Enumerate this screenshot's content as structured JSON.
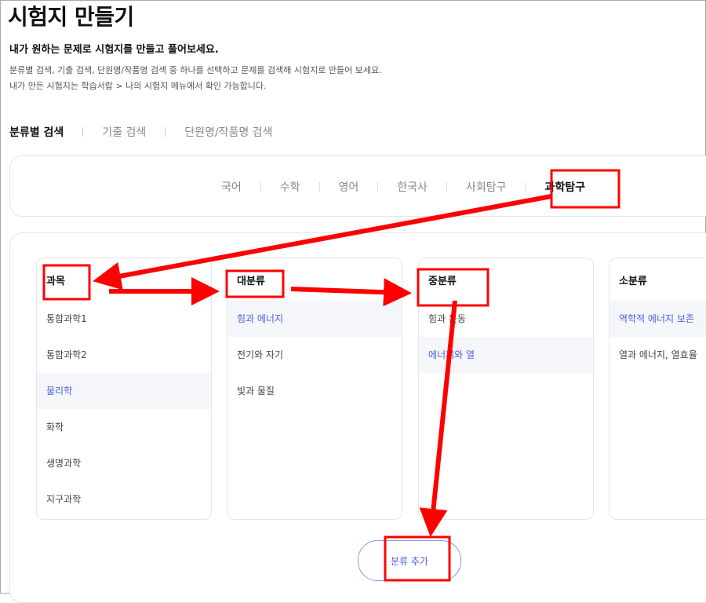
{
  "page": {
    "title": "시험지 만들기",
    "subtitle": "내가 원하는 문제로 시험지를 만들고 풀어보세요.",
    "description": [
      "분류별 검색, 기출 검색, 단원명/작품명 검색 중 하나를 선택하고 문제를 검색해 시험지로 만들어 보세요.",
      "내가 만든 시험지는 학습서랍 > 나의 시험지 메뉴에서 확인 가능합니다."
    ]
  },
  "search_tabs": [
    {
      "label": "분류별 검색",
      "active": true
    },
    {
      "label": "기출 검색",
      "active": false
    },
    {
      "label": "단원명/작품명 검색",
      "active": false
    }
  ],
  "subject_tabs": [
    {
      "label": "국어",
      "active": false
    },
    {
      "label": "수학",
      "active": false
    },
    {
      "label": "영어",
      "active": false
    },
    {
      "label": "한국사",
      "active": false
    },
    {
      "label": "사회탐구",
      "active": false
    },
    {
      "label": "과학탐구",
      "active": true
    }
  ],
  "columns": [
    {
      "title": "과목",
      "items": [
        {
          "label": "통합과학1",
          "selected": false
        },
        {
          "label": "통합과학2",
          "selected": false
        },
        {
          "label": "물리학",
          "selected": true
        },
        {
          "label": "화학",
          "selected": false
        },
        {
          "label": "생명과학",
          "selected": false
        },
        {
          "label": "지구과학",
          "selected": false
        }
      ]
    },
    {
      "title": "대분류",
      "items": [
        {
          "label": "힘과 에너지",
          "selected": true
        },
        {
          "label": "전기와 자기",
          "selected": false
        },
        {
          "label": "빛과 물질",
          "selected": false
        }
      ]
    },
    {
      "title": "중분류",
      "items": [
        {
          "label": "힘과 운동",
          "selected": false
        },
        {
          "label": "에너지와 열",
          "selected": true
        }
      ]
    },
    {
      "title": "소분류",
      "items": [
        {
          "label": "역학적 에너지 보존",
          "selected": true
        },
        {
          "label": "열과 에너지, 열효율",
          "selected": false
        }
      ]
    }
  ],
  "add_button": {
    "label": "분류 추가"
  },
  "colors": {
    "accent": "#4a5ee0",
    "annotation": "#ff0000",
    "selected_bg": "#f5f6fa"
  }
}
